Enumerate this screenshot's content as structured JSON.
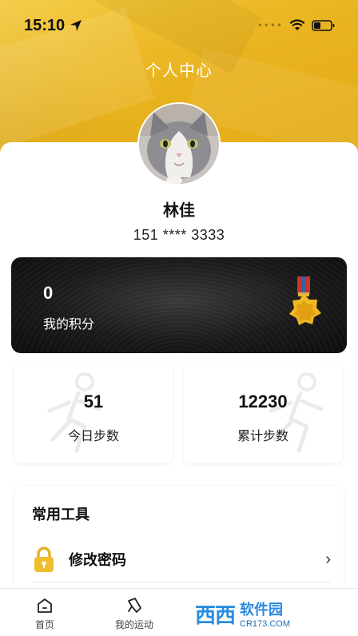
{
  "status_bar": {
    "time": "15:10",
    "signal_dots": "••••",
    "icons": [
      "location-arrow-icon",
      "wifi-icon",
      "battery-icon"
    ]
  },
  "header": {
    "title": "个人中心"
  },
  "profile": {
    "name": "林佳",
    "phone": "151 **** 3333"
  },
  "points": {
    "value": "0",
    "label": "我的积分"
  },
  "steps": {
    "today": {
      "value": "51",
      "label": "今日步数"
    },
    "total": {
      "value": "12230",
      "label": "累计步数"
    }
  },
  "tools": {
    "title": "常用工具",
    "items": [
      {
        "label": "修改密码",
        "icon": "lock-icon"
      }
    ]
  },
  "tab_bar": {
    "tabs": [
      {
        "label": "首页",
        "icon": "home-icon"
      },
      {
        "label": "我的运动",
        "icon": "sport-icon"
      }
    ]
  },
  "watermark": {
    "logo": "西西",
    "title": "软件园",
    "url": "CR173.COM"
  },
  "colors": {
    "header_gold": "#e9b31f",
    "card_black": "#1a1a1a",
    "accent_blue": "#2a8be0"
  }
}
